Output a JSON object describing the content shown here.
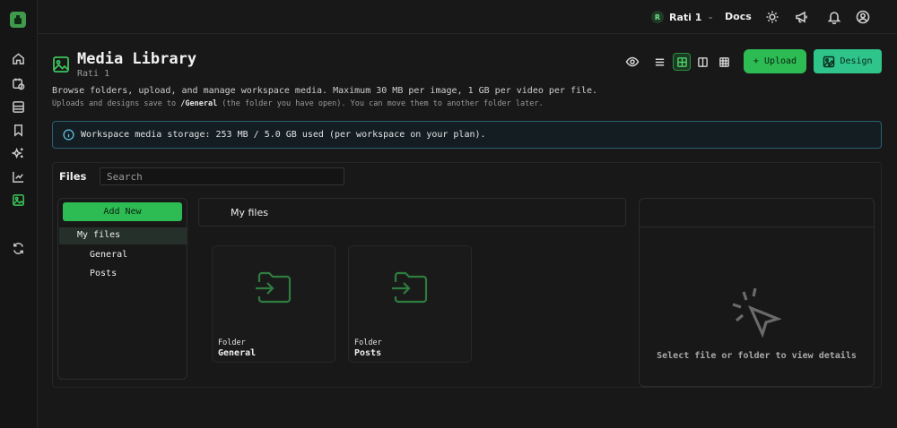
{
  "workspace": {
    "badge": "R",
    "name": "Rati 1"
  },
  "topbar": {
    "docs_label": "Docs"
  },
  "sidebar": {
    "icons": [
      "home-icon",
      "calendar-clock-icon",
      "layout-icon",
      "bookmark-icon",
      "sparkles-icon",
      "chart-icon",
      "image-icon",
      "refresh-icon"
    ],
    "active": "image-icon"
  },
  "header": {
    "title": "Media Library",
    "subtitle": "Rati 1",
    "description": "Browse folders, upload, and manage workspace media. Maximum 30 MB per image, 1 GB per video per file.",
    "note_prefix": "Uploads and designs save to ",
    "note_path": "/General",
    "note_suffix": " (the folder you have open). You can move them to another folder later."
  },
  "toolbar": {
    "upload_label": "+ Upload",
    "design_label": "Design"
  },
  "storage": {
    "text": "Workspace media storage: 253 MB / 5.0 GB used (per workspace on your plan)."
  },
  "files": {
    "label": "Files",
    "search_placeholder": "Search",
    "add_new_label": "Add New",
    "tree": [
      {
        "label": "My files"
      },
      {
        "label": "General"
      },
      {
        "label": "Posts"
      }
    ],
    "breadcrumb": "My files",
    "folders": [
      {
        "type": "Folder",
        "name": "General"
      },
      {
        "type": "Folder",
        "name": "Posts"
      }
    ],
    "details_empty": "Select file or folder to view details"
  },
  "colors": {
    "accent": "#2dbb54",
    "design": "#2ec48a",
    "info_border": "#2a5f72"
  }
}
